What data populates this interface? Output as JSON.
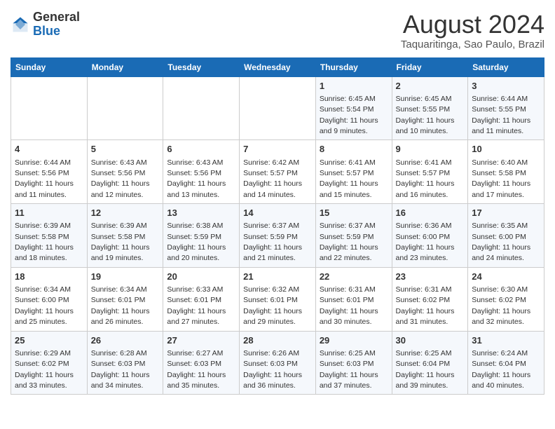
{
  "header": {
    "logo": {
      "general": "General",
      "blue": "Blue"
    },
    "title": "August 2024",
    "subtitle": "Taquaritinga, Sao Paulo, Brazil"
  },
  "days_of_week": [
    "Sunday",
    "Monday",
    "Tuesday",
    "Wednesday",
    "Thursday",
    "Friday",
    "Saturday"
  ],
  "weeks": [
    [
      {
        "day": "",
        "detail": ""
      },
      {
        "day": "",
        "detail": ""
      },
      {
        "day": "",
        "detail": ""
      },
      {
        "day": "",
        "detail": ""
      },
      {
        "day": "1",
        "detail": "Sunrise: 6:45 AM\nSunset: 5:54 PM\nDaylight: 11 hours\nand 9 minutes."
      },
      {
        "day": "2",
        "detail": "Sunrise: 6:45 AM\nSunset: 5:55 PM\nDaylight: 11 hours\nand 10 minutes."
      },
      {
        "day": "3",
        "detail": "Sunrise: 6:44 AM\nSunset: 5:55 PM\nDaylight: 11 hours\nand 11 minutes."
      }
    ],
    [
      {
        "day": "4",
        "detail": "Sunrise: 6:44 AM\nSunset: 5:56 PM\nDaylight: 11 hours\nand 11 minutes."
      },
      {
        "day": "5",
        "detail": "Sunrise: 6:43 AM\nSunset: 5:56 PM\nDaylight: 11 hours\nand 12 minutes."
      },
      {
        "day": "6",
        "detail": "Sunrise: 6:43 AM\nSunset: 5:56 PM\nDaylight: 11 hours\nand 13 minutes."
      },
      {
        "day": "7",
        "detail": "Sunrise: 6:42 AM\nSunset: 5:57 PM\nDaylight: 11 hours\nand 14 minutes."
      },
      {
        "day": "8",
        "detail": "Sunrise: 6:41 AM\nSunset: 5:57 PM\nDaylight: 11 hours\nand 15 minutes."
      },
      {
        "day": "9",
        "detail": "Sunrise: 6:41 AM\nSunset: 5:57 PM\nDaylight: 11 hours\nand 16 minutes."
      },
      {
        "day": "10",
        "detail": "Sunrise: 6:40 AM\nSunset: 5:58 PM\nDaylight: 11 hours\nand 17 minutes."
      }
    ],
    [
      {
        "day": "11",
        "detail": "Sunrise: 6:39 AM\nSunset: 5:58 PM\nDaylight: 11 hours\nand 18 minutes."
      },
      {
        "day": "12",
        "detail": "Sunrise: 6:39 AM\nSunset: 5:58 PM\nDaylight: 11 hours\nand 19 minutes."
      },
      {
        "day": "13",
        "detail": "Sunrise: 6:38 AM\nSunset: 5:59 PM\nDaylight: 11 hours\nand 20 minutes."
      },
      {
        "day": "14",
        "detail": "Sunrise: 6:37 AM\nSunset: 5:59 PM\nDaylight: 11 hours\nand 21 minutes."
      },
      {
        "day": "15",
        "detail": "Sunrise: 6:37 AM\nSunset: 5:59 PM\nDaylight: 11 hours\nand 22 minutes."
      },
      {
        "day": "16",
        "detail": "Sunrise: 6:36 AM\nSunset: 6:00 PM\nDaylight: 11 hours\nand 23 minutes."
      },
      {
        "day": "17",
        "detail": "Sunrise: 6:35 AM\nSunset: 6:00 PM\nDaylight: 11 hours\nand 24 minutes."
      }
    ],
    [
      {
        "day": "18",
        "detail": "Sunrise: 6:34 AM\nSunset: 6:00 PM\nDaylight: 11 hours\nand 25 minutes."
      },
      {
        "day": "19",
        "detail": "Sunrise: 6:34 AM\nSunset: 6:01 PM\nDaylight: 11 hours\nand 26 minutes."
      },
      {
        "day": "20",
        "detail": "Sunrise: 6:33 AM\nSunset: 6:01 PM\nDaylight: 11 hours\nand 27 minutes."
      },
      {
        "day": "21",
        "detail": "Sunrise: 6:32 AM\nSunset: 6:01 PM\nDaylight: 11 hours\nand 29 minutes."
      },
      {
        "day": "22",
        "detail": "Sunrise: 6:31 AM\nSunset: 6:01 PM\nDaylight: 11 hours\nand 30 minutes."
      },
      {
        "day": "23",
        "detail": "Sunrise: 6:31 AM\nSunset: 6:02 PM\nDaylight: 11 hours\nand 31 minutes."
      },
      {
        "day": "24",
        "detail": "Sunrise: 6:30 AM\nSunset: 6:02 PM\nDaylight: 11 hours\nand 32 minutes."
      }
    ],
    [
      {
        "day": "25",
        "detail": "Sunrise: 6:29 AM\nSunset: 6:02 PM\nDaylight: 11 hours\nand 33 minutes."
      },
      {
        "day": "26",
        "detail": "Sunrise: 6:28 AM\nSunset: 6:03 PM\nDaylight: 11 hours\nand 34 minutes."
      },
      {
        "day": "27",
        "detail": "Sunrise: 6:27 AM\nSunset: 6:03 PM\nDaylight: 11 hours\nand 35 minutes."
      },
      {
        "day": "28",
        "detail": "Sunrise: 6:26 AM\nSunset: 6:03 PM\nDaylight: 11 hours\nand 36 minutes."
      },
      {
        "day": "29",
        "detail": "Sunrise: 6:25 AM\nSunset: 6:03 PM\nDaylight: 11 hours\nand 37 minutes."
      },
      {
        "day": "30",
        "detail": "Sunrise: 6:25 AM\nSunset: 6:04 PM\nDaylight: 11 hours\nand 39 minutes."
      },
      {
        "day": "31",
        "detail": "Sunrise: 6:24 AM\nSunset: 6:04 PM\nDaylight: 11 hours\nand 40 minutes."
      }
    ]
  ]
}
